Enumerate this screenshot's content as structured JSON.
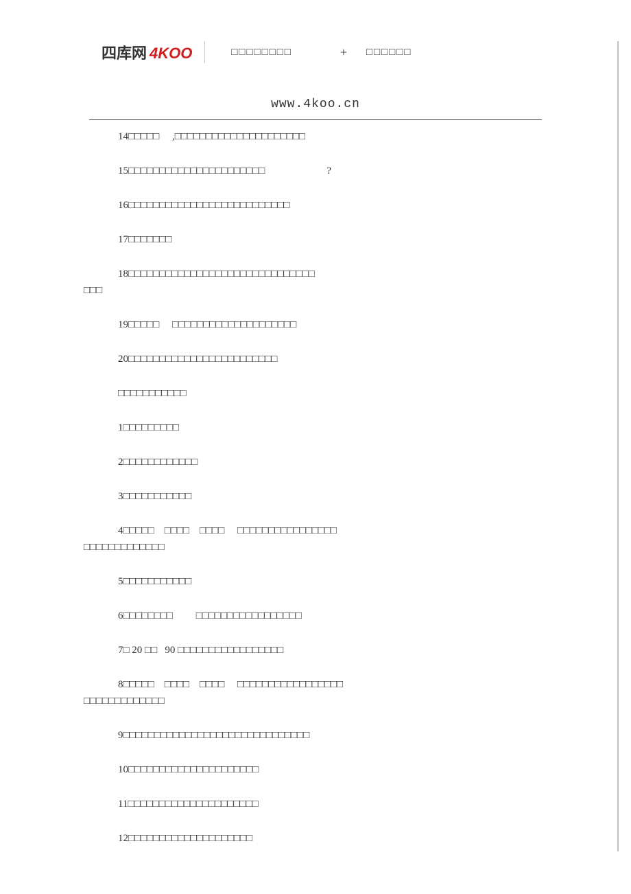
{
  "header": {
    "logo_cn": "四库网",
    "logo_en": "4KOO",
    "text1": "□□□□□□□□",
    "plus": "+",
    "text2": "□□□□□□",
    "url": "www.4koo.cn"
  },
  "lines": {
    "l14": "14□□□□□     ,□□□□□□□□□□□□□□□□□□□□□",
    "l15": "15□□□□□□□□□□□□□□□□□□□□□□                        ?",
    "l16": "16□□□□□□□□□□□□□□□□□□□□□□□□□□",
    "l17": "17□□□□□□□",
    "l18a": "18□□□□□□□□□□□□□□□□□□□□□□□□□□□□□□",
    "l18b": "□□□",
    "l19": "19□□□□□     □□□□□□□□□□□□□□□□□□□□",
    "l20": "20□□□□□□□□□□□□□□□□□□□□□□□□",
    "section": "□□□□□□□□□□□",
    "s1": "1□□□□□□□□□",
    "s2": "2□□□□□□□□□□□□",
    "s3": "3□□□□□□□□□□□",
    "s4a": "4□□□□□    □□□□    □□□□     □□□□□□□□□□□□□□□□",
    "s4b": "□□□□□□□□□□□□□",
    "s5": "5□□□□□□□□□□□",
    "s6": "6□□□□□□□□         □□□□□□□□□□□□□□□□□",
    "s7": "7□ 20 □□   90 □□□□□□□□□□□□□□□□□",
    "s8a": "8□□□□□    □□□□    □□□□     □□□□□□□□□□□□□□□□□",
    "s8b": "□□□□□□□□□□□□□",
    "s9": "9□□□□□□□□□□□□□□□□□□□□□□□□□□□□□□",
    "s10": "10□□□□□□□□□□□□□□□□□□□□□",
    "s11": "11□□□□□□□□□□□□□□□□□□□□□",
    "s12": "12□□□□□□□□□□□□□□□□□□□□"
  }
}
